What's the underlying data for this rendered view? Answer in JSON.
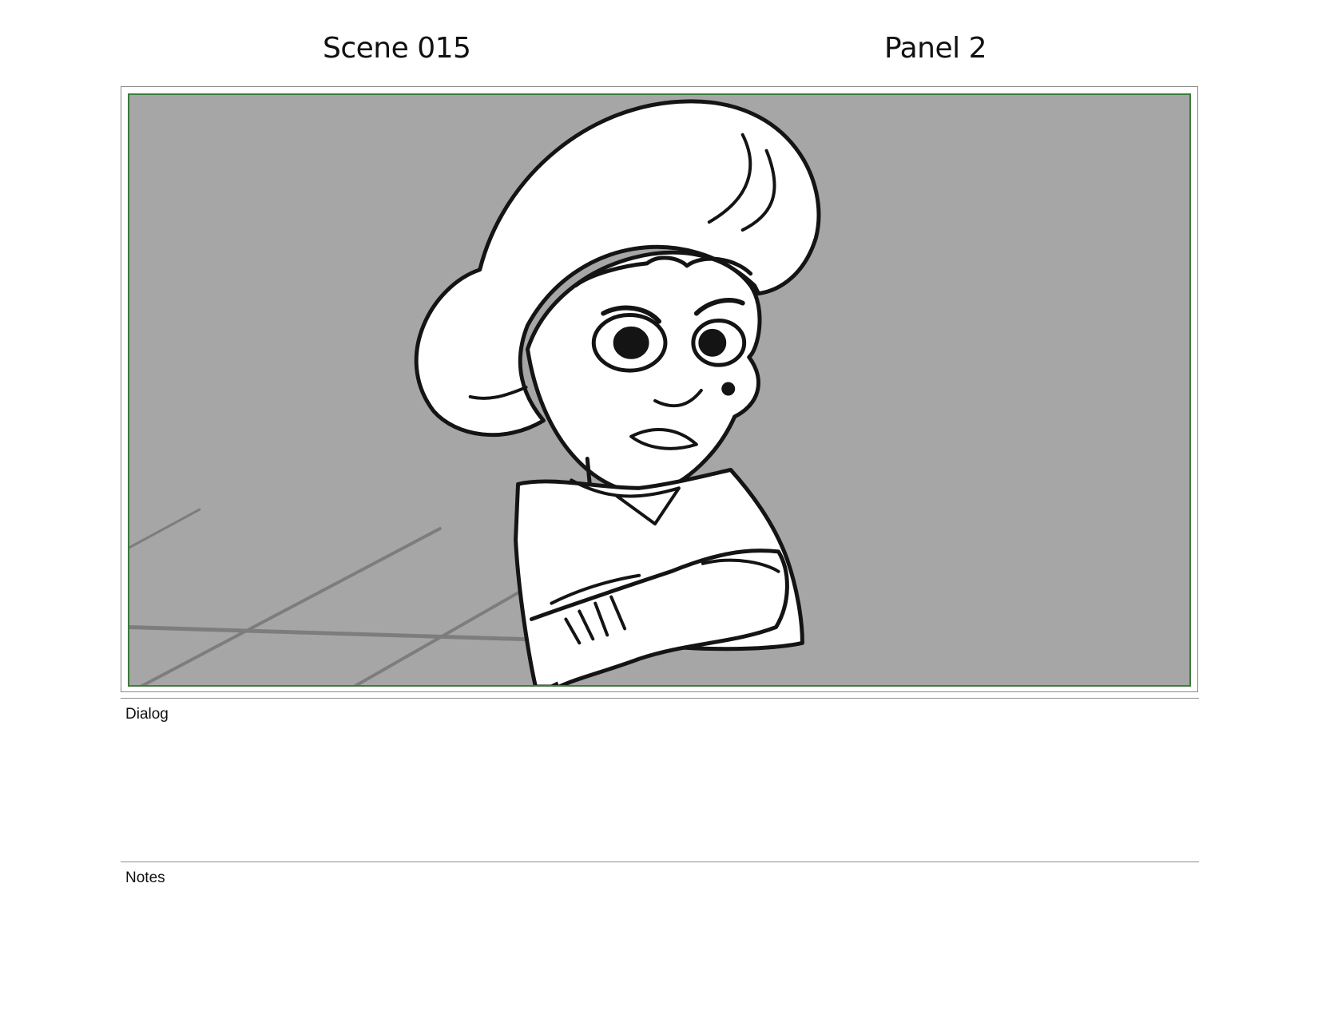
{
  "header": {
    "scene_label": "Scene 015",
    "panel_label": "Panel 2"
  },
  "panel_image": {
    "description_icon": "storyboard-sketch-girl-arms-crossed",
    "background_color": "#a6a6a6",
    "safe_frame_color": "#3d7a3d"
  },
  "dialog": {
    "label": "Dialog",
    "text": ""
  },
  "notes": {
    "label": "Notes",
    "text": ""
  }
}
